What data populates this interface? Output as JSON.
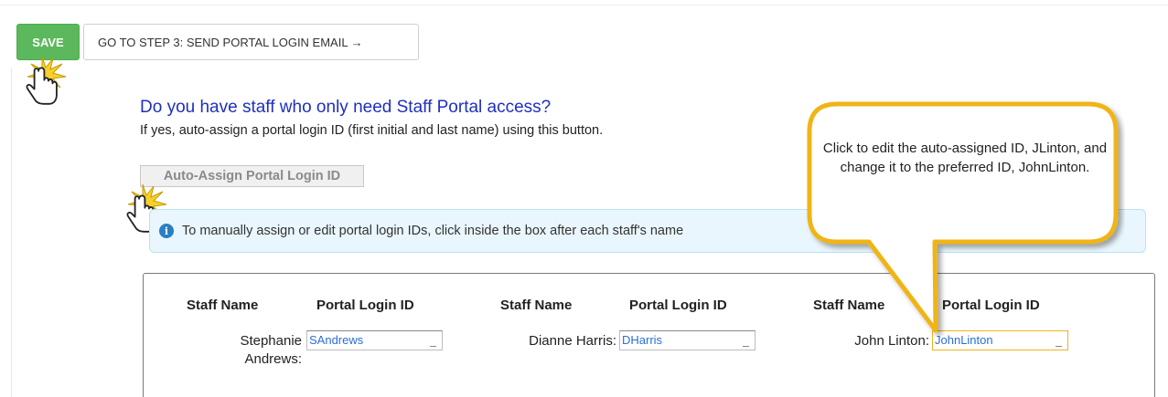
{
  "toolbar": {
    "save_label": "SAVE",
    "step_label": "GO TO STEP 3: SEND PORTAL LOGIN EMAIL",
    "step_arrow": "→"
  },
  "section": {
    "title": "Do you have staff who only need Staff Portal access?",
    "description": "If yes, auto-assign a portal login ID (first initial and last name) using this button.",
    "auto_assign_label": "Auto-Assign Portal Login ID"
  },
  "info": {
    "icon": "i",
    "text": "To manually assign or edit portal login IDs, click inside the box after each staff's name"
  },
  "table": {
    "headers": {
      "staff_name": "Staff Name",
      "portal_login_id": "Portal Login ID"
    },
    "rows": [
      {
        "name_line1": "Stephanie",
        "name_line2": "Andrews:",
        "login_id": "SAndrews"
      },
      {
        "name_line1": "Dianne Harris:",
        "name_line2": "",
        "login_id": "DHarris"
      },
      {
        "name_line1": "John Linton:",
        "name_line2": "",
        "login_id": "JohnLinton"
      }
    ]
  },
  "callout": {
    "text": "Click to edit the auto-assigned ID, JLinton, and change it to the preferred ID, JohnLinton."
  },
  "colors": {
    "save_green": "#5cb85c",
    "title_blue": "#1f2fbf",
    "callout_border": "#f0b418",
    "info_bg": "#e9f6fd",
    "input_text": "#2a6fd6"
  }
}
